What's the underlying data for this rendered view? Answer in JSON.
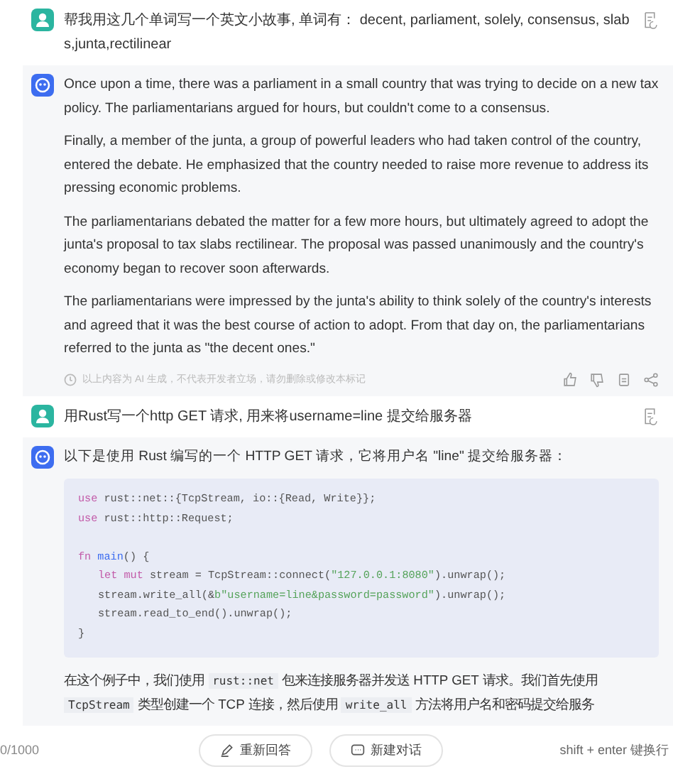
{
  "messages": [
    {
      "kind": "user",
      "text": "帮我用这几个单词写一个英文小故事, 单词有： decent, parliament, solely, consensus, slabs,junta,rectilinear"
    },
    {
      "kind": "ai",
      "paragraphs": [
        "Once upon a time, there was a parliament in a small country that was trying to decide on a new tax policy. The parliamentarians argued for hours, but couldn't come to a consensus.",
        "Finally, a member of the junta, a group of powerful leaders who had taken control of the country, entered the debate. He emphasized that the country needed to raise more revenue to address its pressing economic problems.",
        "The parliamentarians debated the matter for a few more hours, but ultimately agreed to adopt the junta's proposal to tax slabs rectilinear. The proposal was passed unanimously and the country's economy began to recover soon afterwards.",
        "The parliamentarians were impressed by the junta's ability to think solely of the country's interests and agreed that it was the best course of action to adopt. From that day on, the parliamentarians referred to the junta as \"the decent ones.\""
      ],
      "disclaimer": "以上内容为 AI 生成，不代表开发者立场，请勿删除或修改本标记"
    },
    {
      "kind": "user",
      "text": "用Rust写一个http GET 请求, 用来将username=line 提交给服务器"
    },
    {
      "kind": "ai",
      "intro": "以下是使用 Rust 编写的一个 HTTP GET 请求，它将用户名 \"line\" 提交给服务器：",
      "code": [
        {
          "kind": "top",
          "tokens": [
            {
              "kind": "kw",
              "t": "use"
            },
            {
              "kind": "plain",
              "t": " rust::net::{TcpStream, io::{Read, Write}};"
            }
          ]
        },
        {
          "kind": "top",
          "tokens": [
            {
              "kind": "kw",
              "t": "use"
            },
            {
              "kind": "plain",
              "t": " rust::http::Request;"
            }
          ]
        },
        {
          "kind": "blank"
        },
        {
          "kind": "top",
          "tokens": [
            {
              "kind": "kw",
              "t": "fn"
            },
            {
              "kind": "fn",
              "t": " main"
            },
            {
              "kind": "plain",
              "t": "() {"
            }
          ]
        },
        {
          "kind": "indented",
          "tokens": [
            {
              "kind": "kw",
              "t": "let mut"
            },
            {
              "kind": "plain",
              "t": " stream = TcpStream::connect("
            },
            {
              "kind": "str",
              "t": "\"127.0.0.1:8080\""
            },
            {
              "kind": "plain",
              "t": ").unwrap();"
            }
          ]
        },
        {
          "kind": "indented",
          "tokens": [
            {
              "kind": "plain",
              "t": "stream.write_all(&"
            },
            {
              "kind": "str",
              "t": "b\"username=line&password=password\""
            },
            {
              "kind": "plain",
              "t": ").unwrap();"
            }
          ]
        },
        {
          "kind": "indented",
          "tokens": [
            {
              "kind": "plain",
              "t": "stream.read_to_end().unwrap();"
            }
          ]
        },
        {
          "kind": "top",
          "tokens": [
            {
              "kind": "plain",
              "t": "}"
            }
          ]
        }
      ],
      "after": [
        {
          "kind": "text",
          "t": "在这个例子中，我们使用 "
        },
        {
          "kind": "code",
          "t": "rust::net"
        },
        {
          "kind": "text",
          "t": " 包来连接服务器并发送 HTTP GET 请求。我们首先使用 "
        },
        {
          "kind": "code",
          "t": "TcpStream"
        },
        {
          "kind": "text",
          "t": " 类型创建一个 TCP 连接，然后使用 "
        },
        {
          "kind": "code",
          "t": "write_all"
        },
        {
          "kind": "text",
          "t": " 方法将用户名和密码提交给服务"
        }
      ]
    }
  ],
  "footer": {
    "counter": "0/1000",
    "buttons": [
      {
        "label": "重新回答"
      },
      {
        "label": "新建对话"
      }
    ],
    "hint": "shift + enter 键换行"
  }
}
